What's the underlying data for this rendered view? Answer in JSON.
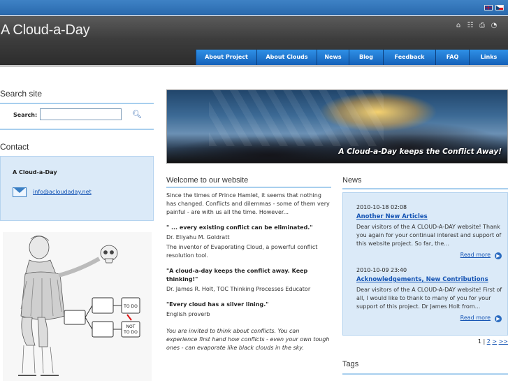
{
  "header": {
    "title": "A Cloud-a-Day",
    "languages": [
      "English",
      "Czech"
    ],
    "tools": [
      "home-icon",
      "sitemap-icon",
      "print-icon",
      "rss-icon"
    ]
  },
  "nav": {
    "items": [
      {
        "label": "About Project"
      },
      {
        "label": "About Clouds"
      },
      {
        "label": "News"
      },
      {
        "label": "Blog"
      },
      {
        "label": "Feedback"
      },
      {
        "label": "FAQ"
      },
      {
        "label": "Links"
      }
    ]
  },
  "search": {
    "title": "Search site",
    "label": "Search:",
    "value": "",
    "placeholder": ""
  },
  "contact": {
    "title": "Contact",
    "org": "A Cloud-a-Day",
    "email": "info@acloudaday.net"
  },
  "banner": {
    "caption": "A Cloud-a-Day keeps the Conflict Away!"
  },
  "illustration": {
    "box_top_right": "TO DO",
    "box_bottom_right_line1": "NOT",
    "box_bottom_right_line2": "TO DO"
  },
  "welcome": {
    "title": "Welcome to our website",
    "intro": "Since the times of Prince Hamlet, it seems that nothing has changed. Conflicts and dilemmas - some of them very painful - are with us all the time. However...",
    "quotes": [
      {
        "text": "\" ... every existing conflict can be eliminated.\"",
        "author": "Dr. Eliyahu M. Goldratt",
        "note": "The inventor of Evaporating Cloud, a powerful conflict resolution tool."
      },
      {
        "text": "\"A cloud-a-day keeps the conflict away. Keep thinking!\"",
        "author": "Dr. James R. Holt, TOC Thinking Processes Educator",
        "note": ""
      },
      {
        "text": "\"Every cloud has a silver lining.\"",
        "author": "English proverb",
        "note": ""
      }
    ],
    "outro": "You are invited to think about conflicts. You can experience first hand how conflicts - even your own tough ones - can evaporate like black clouds in the sky."
  },
  "news": {
    "title": "News",
    "items": [
      {
        "date": "2010-10-18 02:08",
        "title": "Another New Articles",
        "text": "Dear visitors of the A CLOUD-A-DAY website! Thank you again for your continual interest and support of this website project. So far, the...",
        "more": "Read more"
      },
      {
        "date": "2010-10-09 23:40",
        "title": "Acknowledgements, New Contributions",
        "text": "Dear visitors of the A CLOUD-A-DAY website! First of all, I would like to thank to many of you for your support of this project. Dr James Holt from...",
        "more": "Read more"
      }
    ],
    "pager": {
      "current": "1",
      "sep": "|",
      "next_page": "2",
      "next": ">",
      "last": ">>"
    }
  },
  "tags": {
    "title": "Tags"
  }
}
